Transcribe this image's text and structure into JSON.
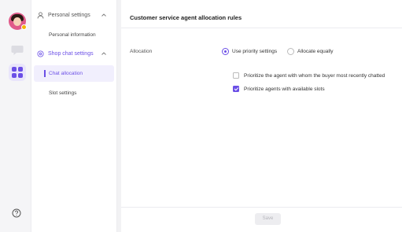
{
  "rail": {
    "icons": [
      "avatar",
      "chat-icon",
      "apps-grid-icon",
      "help-icon"
    ],
    "accent": "#6b4fe6"
  },
  "nav": {
    "groups": [
      {
        "label": "Personal settings",
        "icon": "person-icon",
        "expanded": true,
        "items": [
          {
            "label": "Personal information",
            "selected": false
          }
        ]
      },
      {
        "label": "Shop chat settings",
        "icon": "gear-icon",
        "expanded": true,
        "items": [
          {
            "label": "Chat allocation",
            "selected": true
          },
          {
            "label": "Slot settings",
            "selected": false
          }
        ]
      }
    ]
  },
  "main": {
    "title": "Customer service agent allocation rules",
    "allocation": {
      "label": "Allocation",
      "options": [
        {
          "label": "Use priority settings",
          "checked": true
        },
        {
          "label": "Allocate equally",
          "checked": false
        }
      ]
    },
    "checkboxes": [
      {
        "label": "Prioritize the agent with whom the buyer most recently chatted",
        "checked": false
      },
      {
        "label": "Prioritize agents with available slots",
        "checked": true
      }
    ],
    "save_label": "Save"
  }
}
